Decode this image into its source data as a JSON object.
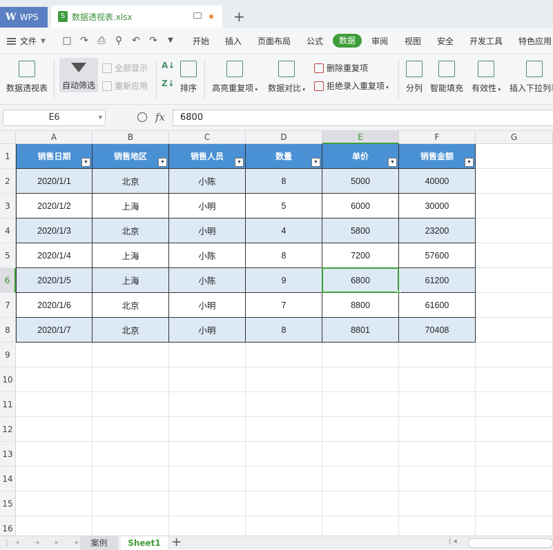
{
  "title_bar": {
    "app_tab": "WPS",
    "file_tab": "数据透视表.xlsx"
  },
  "menu": {
    "file": "文件",
    "items": [
      "开始",
      "插入",
      "页面布局",
      "公式",
      "数据",
      "审阅",
      "视图",
      "安全",
      "开发工具",
      "特色应用"
    ],
    "active": "数据"
  },
  "ribbon": {
    "pivot": "数据透视表",
    "autofilter": "自动筛选",
    "show_all": "全部显示",
    "reapply": "重新应用",
    "sort": "排序",
    "highlight_dup": "高亮重复项",
    "compare": "数据对比",
    "remove_dup": "删除重复项",
    "reject_dup": "拒绝录入重复项",
    "split": "分列",
    "smart_fill": "智能填充",
    "validity": "有效性",
    "insert_dropdown": "插入下拉列表"
  },
  "formula_bar": {
    "cell_ref": "E6",
    "fx": "fx",
    "value": "6800"
  },
  "columns": [
    "A",
    "B",
    "C",
    "D",
    "E",
    "F",
    "G"
  ],
  "rows": [
    "1",
    "2",
    "3",
    "4",
    "5",
    "6",
    "7",
    "8",
    "9",
    "10",
    "11",
    "12",
    "13",
    "14",
    "15",
    "16"
  ],
  "table": {
    "headers": [
      "销售日期",
      "销售地区",
      "销售人员",
      "数量",
      "单价",
      "销售金额"
    ],
    "data": [
      [
        "2020/1/1",
        "北京",
        "小陈",
        "8",
        "5000",
        "40000"
      ],
      [
        "2020/1/2",
        "上海",
        "小明",
        "5",
        "6000",
        "30000"
      ],
      [
        "2020/1/3",
        "北京",
        "小明",
        "4",
        "5800",
        "23200"
      ],
      [
        "2020/1/4",
        "上海",
        "小陈",
        "8",
        "7200",
        "57600"
      ],
      [
        "2020/1/5",
        "上海",
        "小陈",
        "9",
        "6800",
        "61200"
      ],
      [
        "2020/1/6",
        "北京",
        "小明",
        "7",
        "8800",
        "61600"
      ],
      [
        "2020/1/7",
        "北京",
        "小明",
        "8",
        "8801",
        "70408"
      ]
    ]
  },
  "selection": {
    "column": "E",
    "row": "6"
  },
  "sheets": {
    "tabs": [
      "案例",
      "Sheet1"
    ],
    "active": "Sheet1"
  },
  "colors": {
    "accent_green": "#3f9e3a",
    "header_blue": "#4a90d4",
    "band_blue": "#dde9f5"
  }
}
